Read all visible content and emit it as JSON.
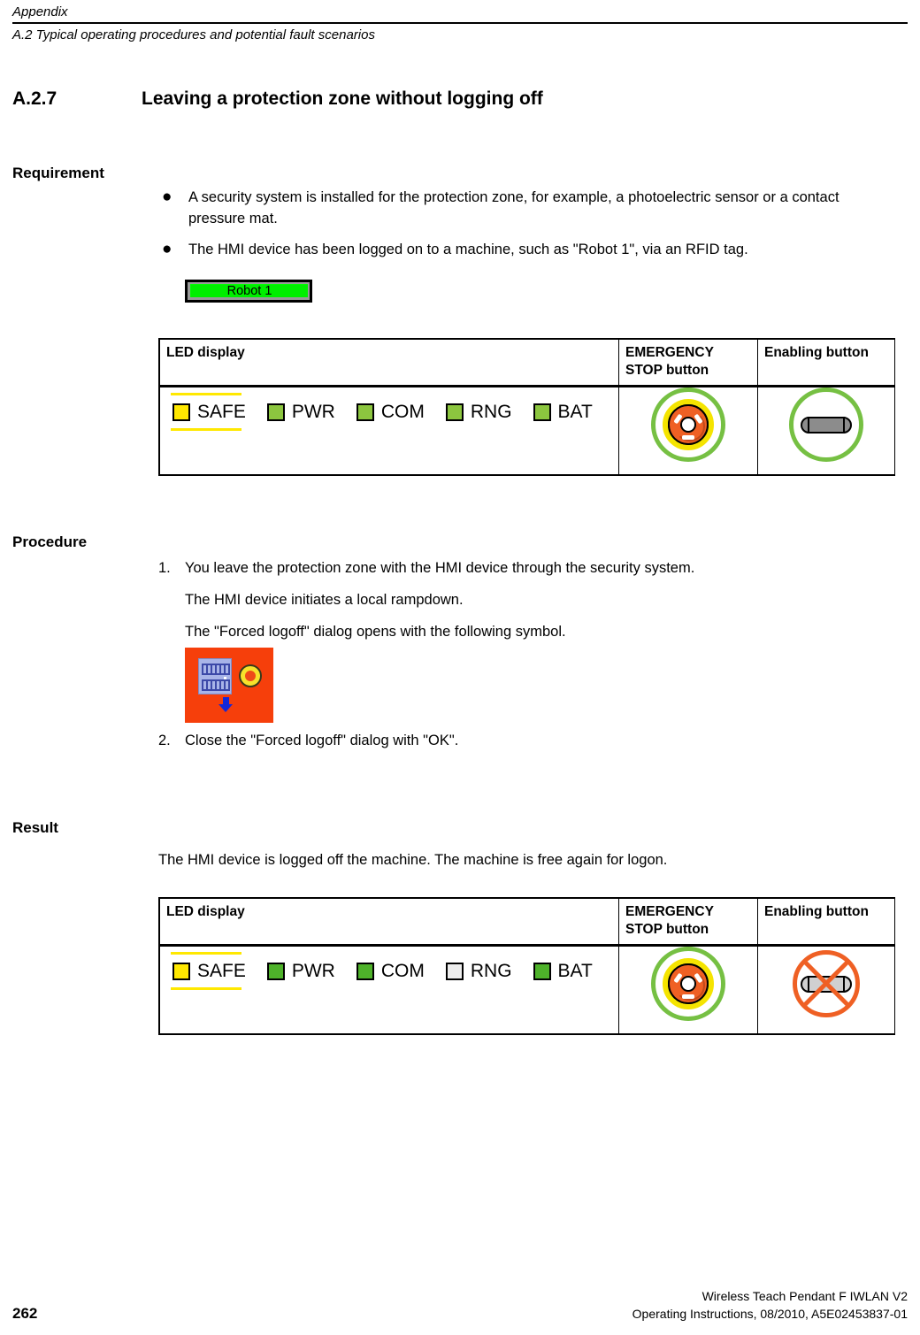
{
  "header": {
    "chapter": "Appendix",
    "section": "A.2 Typical operating procedures and potential fault scenarios"
  },
  "heading": {
    "number": "A.2.7",
    "title": "Leaving a protection zone without logging off"
  },
  "requirement": {
    "heading": "Requirement",
    "bullets": [
      "A security system is installed for the protection zone, for example, a photoelectric sensor or a contact pressure mat.",
      "The HMI device has been logged on to a machine, such as \"Robot 1\", via an RFID tag."
    ],
    "hmi_button_label": "Robot 1",
    "hmi_button_color": "#00ef00"
  },
  "table_columns": {
    "led": "LED display",
    "estop": "EMERGENCY STOP button",
    "enabling": "Enabling button"
  },
  "table_requirement": {
    "leds": [
      {
        "name": "SAFE",
        "color": "#ffe800",
        "state": "blinking"
      },
      {
        "name": "PWR",
        "color": "#8cc63f",
        "state": "on"
      },
      {
        "name": "COM",
        "color": "#8cc63f",
        "state": "on"
      },
      {
        "name": "RNG",
        "color": "#8cc63f",
        "state": "on"
      },
      {
        "name": "BAT",
        "color": "#8cc63f",
        "state": "on"
      }
    ],
    "estop_state": "enabled",
    "enabling_state": "enabled"
  },
  "table_result": {
    "leds": [
      {
        "name": "SAFE",
        "color": "#ffe800",
        "state": "blinking"
      },
      {
        "name": "PWR",
        "color": "#4eb22a",
        "state": "on"
      },
      {
        "name": "COM",
        "color": "#4eb22a",
        "state": "on"
      },
      {
        "name": "RNG",
        "color": "#ededed",
        "state": "off"
      },
      {
        "name": "BAT",
        "color": "#4eb22a",
        "state": "on"
      }
    ],
    "estop_state": "enabled",
    "enabling_state": "disabled"
  },
  "procedure": {
    "heading": "Procedure",
    "step1_num": "1.",
    "step1_text": "You leave the protection zone with the HMI device through the security system.",
    "step1_sub1": "The HMI device initiates a local rampdown.",
    "step1_sub2": "The \"Forced logoff\" dialog opens with the following symbol.",
    "step2_num": "2.",
    "step2_text": "Close the \"Forced logoff\" dialog with \"OK\"."
  },
  "result": {
    "heading": "Result",
    "text": "The HMI device is logged off the machine. The machine is free again for logon."
  },
  "footer": {
    "product": "Wireless Teach Pendant F IWLAN V2",
    "doc": "Operating Instructions, 08/2010, A5E02453837-01",
    "page": "262"
  }
}
